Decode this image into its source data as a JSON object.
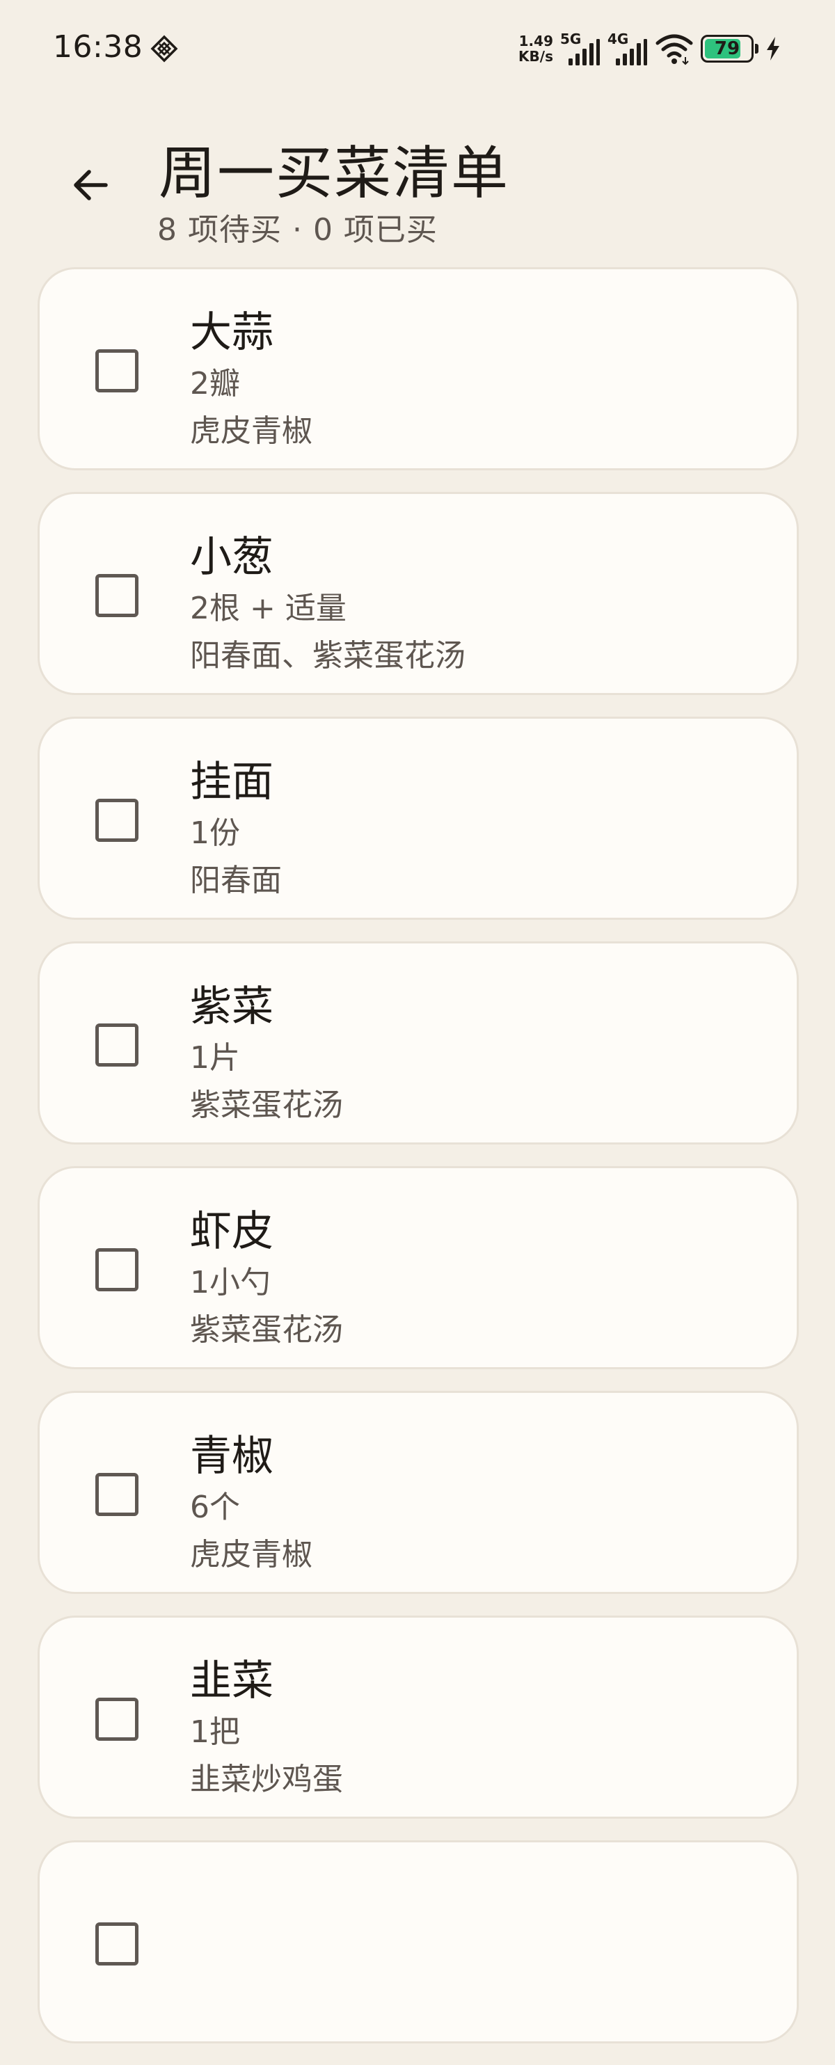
{
  "status_bar": {
    "time": "16:38",
    "net_speed_value": "1.49",
    "net_speed_unit": "KB/s",
    "signal_1_label": "5G",
    "signal_2_label": "4G",
    "battery_level": "79",
    "battery_color": "#2ec27e"
  },
  "header": {
    "title": "周一买菜清单",
    "subtitle": "8 项待买 · 0 项已买"
  },
  "items": [
    {
      "name": "大蒜",
      "quantity": "2瓣",
      "recipe": "虎皮青椒",
      "checked": false
    },
    {
      "name": "小葱",
      "quantity": "2根 + 适量",
      "recipe": "阳春面、紫菜蛋花汤",
      "checked": false
    },
    {
      "name": "挂面",
      "quantity": "1份",
      "recipe": "阳春面",
      "checked": false
    },
    {
      "name": "紫菜",
      "quantity": "1片",
      "recipe": "紫菜蛋花汤",
      "checked": false
    },
    {
      "name": "虾皮",
      "quantity": "1小勺",
      "recipe": "紫菜蛋花汤",
      "checked": false
    },
    {
      "name": "青椒",
      "quantity": "6个",
      "recipe": "虎皮青椒",
      "checked": false
    },
    {
      "name": "韭菜",
      "quantity": "1把",
      "recipe": "韭菜炒鸡蛋",
      "checked": false
    },
    {
      "name": "",
      "quantity": "",
      "recipe": "",
      "checked": false
    }
  ]
}
